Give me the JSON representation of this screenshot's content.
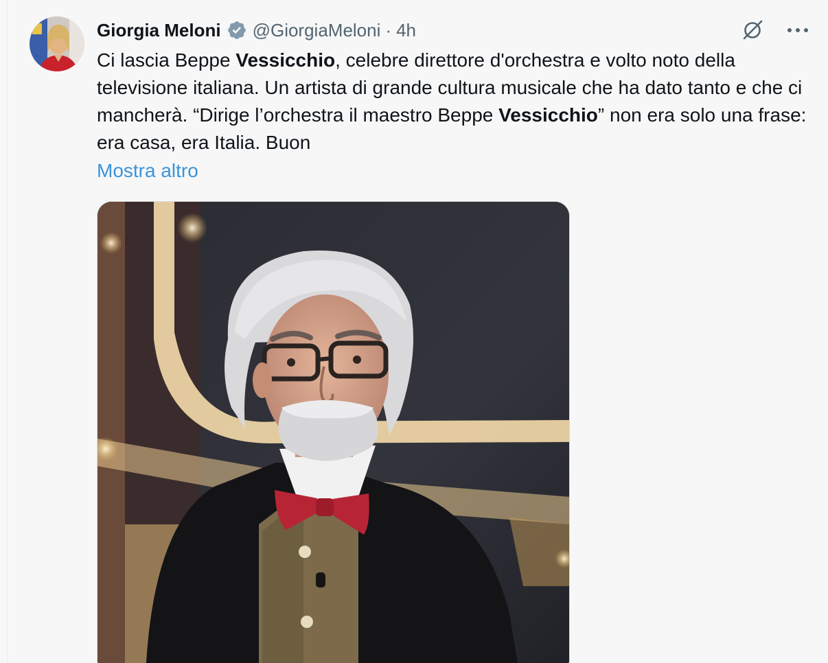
{
  "tweet": {
    "author": {
      "display_name": "Giorgia Meloni",
      "handle": "@GiorgiaMeloni",
      "verified": true
    },
    "separator": "·",
    "timestamp": "4h",
    "text": {
      "p1": "Ci lascia Beppe ",
      "b1": "Vessicchio",
      "p2": ", celebre direttore d'orchestra e volto noto della televisione italiana. Un artista di grande cultura musicale che ha dato tanto e che ci mancherà. “Dirige l’orchestra il maestro Beppe ",
      "b2": "Vessicchio",
      "p3": "” non era solo una frase: era casa, era Italia. Buon"
    },
    "show_more_label": "Mostra altro"
  },
  "icons": {
    "verified": "verified-badge-icon",
    "grok": "grok-icon",
    "more": "more-options-icon"
  },
  "colors": {
    "background": "#f7f7f7",
    "text": "#0f1419",
    "secondary_text": "#536471",
    "link": "#3b94d9"
  }
}
